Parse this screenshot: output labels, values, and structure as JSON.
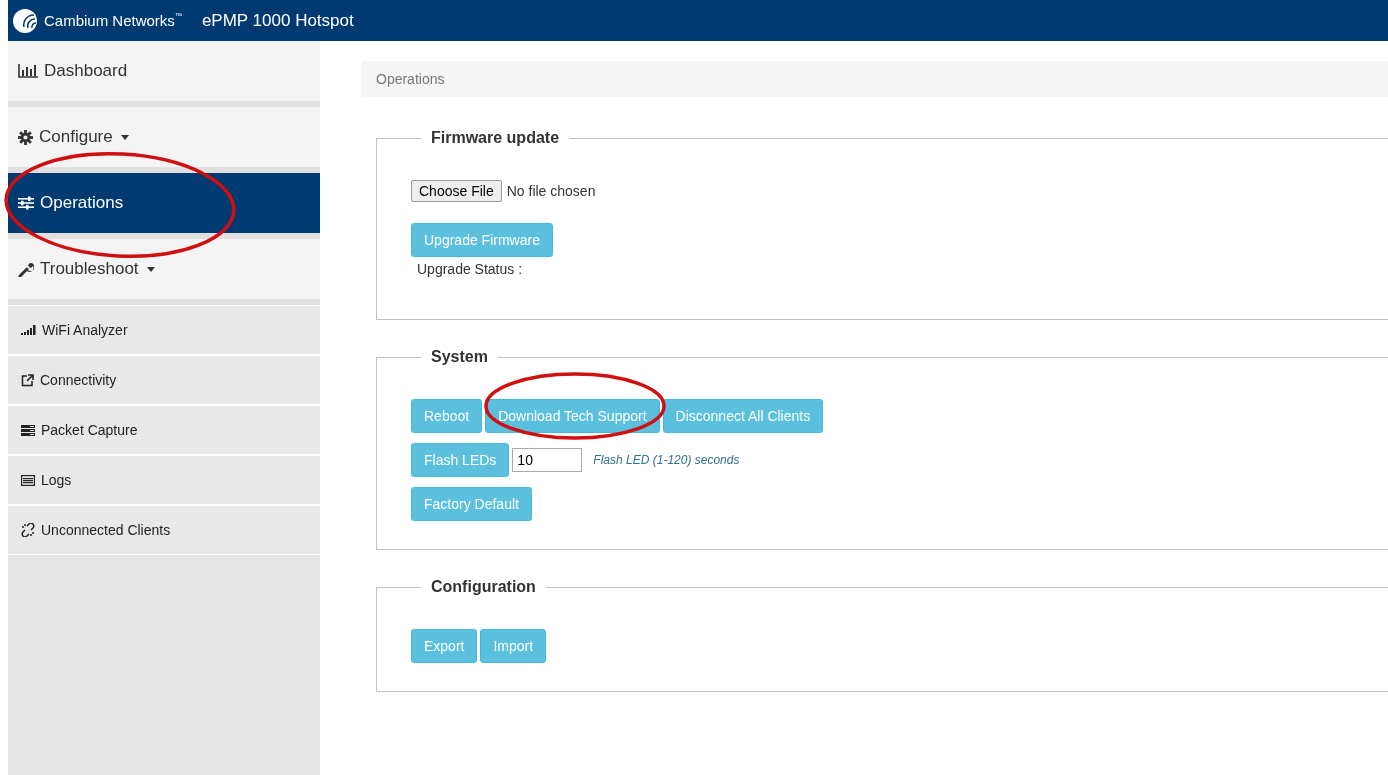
{
  "header": {
    "brand": "Cambium Networks",
    "trademark": "™",
    "title": "ePMP 1000 Hotspot"
  },
  "sidebar": {
    "items": [
      {
        "label": "Dashboard",
        "kind": "link",
        "selected": false
      },
      {
        "label": "Configure",
        "kind": "dropdown",
        "selected": false
      },
      {
        "label": "Operations",
        "kind": "link",
        "selected": true
      },
      {
        "label": "Troubleshoot",
        "kind": "dropdown",
        "selected": false,
        "expanded": true,
        "children": [
          {
            "label": "WiFi Analyzer",
            "selected": false
          },
          {
            "label": "Connectivity",
            "selected": false
          },
          {
            "label": "Packet Capture",
            "selected": false
          },
          {
            "label": "Logs",
            "selected": false
          },
          {
            "label": "Unconnected Clients",
            "selected": false
          }
        ]
      }
    ]
  },
  "breadcrumb": "Operations",
  "sections": [
    {
      "legend": "Firmware update",
      "rows": [
        {
          "kind": "file",
          "button": "Choose File",
          "value": "No file chosen"
        },
        {
          "kind": "buttons",
          "buttons": [
            "Upgrade Firmware"
          ]
        },
        {
          "kind": "status",
          "text": "Upgrade Status :"
        }
      ]
    },
    {
      "legend": "System",
      "rows": [
        {
          "kind": "buttons",
          "buttons": [
            "Reboot",
            "Download Tech Support",
            "Disconnect All Clients"
          ]
        },
        {
          "kind": "input",
          "button": "Flash LEDs",
          "value": "10",
          "hint": "Flash LED (1-120) seconds"
        },
        {
          "kind": "buttons",
          "buttons": [
            "Factory Default"
          ]
        }
      ]
    },
    {
      "legend": "Configuration",
      "rows": [
        {
          "kind": "buttons",
          "buttons": [
            "Export",
            "Import"
          ]
        }
      ]
    }
  ]
}
